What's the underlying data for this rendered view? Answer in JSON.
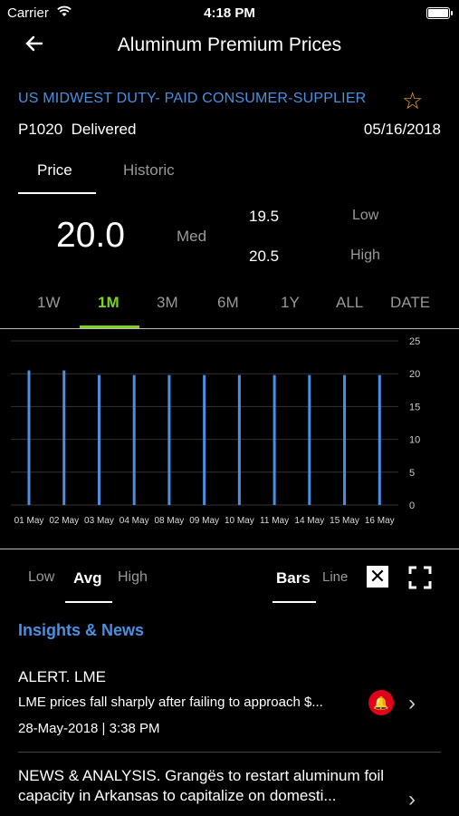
{
  "status_bar": {
    "carrier": "Carrier",
    "time": "4:18 PM"
  },
  "header": {
    "title": "Aluminum Premium Prices"
  },
  "instrument": {
    "name": "US MIDWEST DUTY- PAID CONSUMER-SUPPLIER",
    "code": "P1020",
    "delivery": "Delivered",
    "date": "05/16/2018"
  },
  "tabs": {
    "price": "Price",
    "historic": "Historic"
  },
  "quote": {
    "value": "20.0",
    "med_label": "Med",
    "low": "19.5",
    "low_label": "Low",
    "high": "20.5",
    "high_label": "High"
  },
  "ranges": [
    "1W",
    "1M",
    "3M",
    "6M",
    "1Y",
    "ALL",
    "DATE"
  ],
  "active_range": "1M",
  "chart_data": {
    "type": "bar",
    "categories": [
      "01 May",
      "02 May",
      "03 May",
      "04 May",
      "08 May",
      "09 May",
      "10 May",
      "11 May",
      "14 May",
      "15 May",
      "16 May"
    ],
    "values": [
      20.5,
      20.5,
      19.8,
      19.8,
      19.8,
      19.8,
      19.8,
      19.8,
      19.8,
      19.8,
      19.8
    ],
    "ylim": [
      0,
      25
    ],
    "y_ticks": [
      "25",
      "20",
      "15",
      "10",
      "5",
      "0"
    ],
    "grid": true,
    "bar_color": "#4a90e2"
  },
  "toggles": {
    "low": "Low",
    "avg": "Avg",
    "high": "High",
    "bars": "Bars",
    "line": "Line"
  },
  "section_title": "Insights & News",
  "news": [
    {
      "title": "ALERT. LME",
      "desc": "LME prices fall sharply after failing to approach $...",
      "date": "28-May-2018 | 3:38 PM"
    },
    {
      "title": "NEWS & ANALYSIS. Grangës to restart aluminum foil capacity in Arkansas to capitalize on domesti..."
    }
  ],
  "icons": {
    "wifi": "wifi-icon",
    "battery": "battery-icon",
    "back": "back-arrow-icon",
    "star": "star-outline-icon",
    "close": "close-box-icon",
    "expand": "expand-icon",
    "alert": "alert-bell-icon",
    "chevron": "chevron-right-icon"
  }
}
